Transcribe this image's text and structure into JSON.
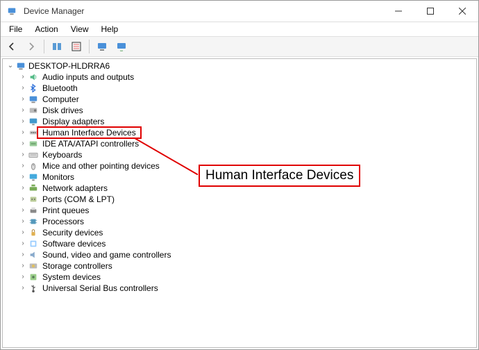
{
  "window": {
    "title": "Device Manager"
  },
  "menubar": {
    "file": "File",
    "action": "Action",
    "view": "View",
    "help": "Help"
  },
  "toolbar": {
    "back": "back",
    "forward": "forward",
    "up": "up",
    "show_hidden": "show-hidden",
    "properties": "properties",
    "refresh": "refresh",
    "help": "help"
  },
  "tree": {
    "root": "DESKTOP-HLDRRA6",
    "items": [
      {
        "icon": "audio",
        "label": "Audio inputs and outputs"
      },
      {
        "icon": "bluetooth",
        "label": "Bluetooth"
      },
      {
        "icon": "computer",
        "label": "Computer"
      },
      {
        "icon": "disk",
        "label": "Disk drives"
      },
      {
        "icon": "display",
        "label": "Display adapters"
      },
      {
        "icon": "hid",
        "label": "Human Interface Devices",
        "highlight": true
      },
      {
        "icon": "ide",
        "label": "IDE ATA/ATAPI controllers"
      },
      {
        "icon": "keyboard",
        "label": "Keyboards"
      },
      {
        "icon": "mouse",
        "label": "Mice and other pointing devices"
      },
      {
        "icon": "monitor",
        "label": "Monitors"
      },
      {
        "icon": "network",
        "label": "Network adapters"
      },
      {
        "icon": "ports",
        "label": "Ports (COM & LPT)"
      },
      {
        "icon": "printqueue",
        "label": "Print queues"
      },
      {
        "icon": "processor",
        "label": "Processors"
      },
      {
        "icon": "security",
        "label": "Security devices"
      },
      {
        "icon": "software",
        "label": "Software devices"
      },
      {
        "icon": "sound",
        "label": "Sound, video and game controllers"
      },
      {
        "icon": "storage",
        "label": "Storage controllers"
      },
      {
        "icon": "system",
        "label": "System devices"
      },
      {
        "icon": "usb",
        "label": "Universal Serial Bus controllers"
      }
    ]
  },
  "callout": {
    "text": "Human Interface Devices"
  }
}
